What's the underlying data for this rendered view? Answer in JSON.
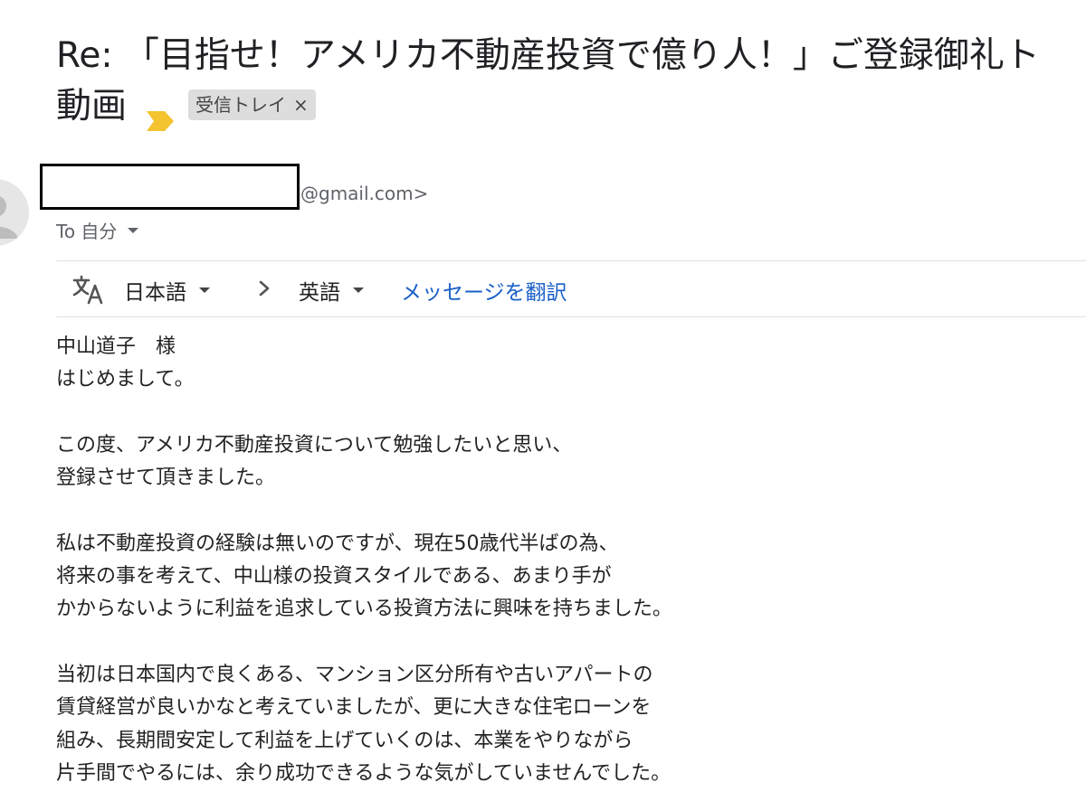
{
  "subject": {
    "text": "Re: 「目指せ！アメリカ不動産投資で億り人！」ご登録御礼ト動画",
    "label_chip": "受信トレイ",
    "chip_close": "×"
  },
  "icons": {
    "important": "important-marker-icon",
    "avatar": "avatar-icon",
    "translate": "translate-icon",
    "arrow": "chevron-right-icon",
    "caret": "caret-down-icon"
  },
  "colors": {
    "important": "#f4c430",
    "link": "#1a5fc8",
    "chip_bg": "#dddddd"
  },
  "sender": {
    "email_visible": "@gmail.com>"
  },
  "recipient": {
    "label": "To 自分"
  },
  "translate_bar": {
    "source_lang": "日本語",
    "target_lang": "英語",
    "translate_link": "メッセージを翻訳"
  },
  "body": {
    "paragraphs": [
      [
        "中山道子　様",
        "はじめまして。"
      ],
      [
        "この度、アメリカ不動産投資について勉強したいと思い、",
        "登録させて頂きました。"
      ],
      [
        "私は不動産投資の経験は無いのですが、現在50歳代半ばの為、",
        "将来の事を考えて、中山様の投資スタイルである、あまり手が",
        "かからないように利益を追求している投資方法に興味を持ちました。"
      ],
      [
        "当初は日本国内で良くある、マンション区分所有や古いアパートの",
        "賃貸経営が良いかなと考えていましたが、更に大きな住宅ローンを",
        "組み、長期間安定して利益を上げていくのは、本業をやりながら",
        "片手間でやるには、余り成功できるような気がしていませんでした。"
      ]
    ]
  }
}
